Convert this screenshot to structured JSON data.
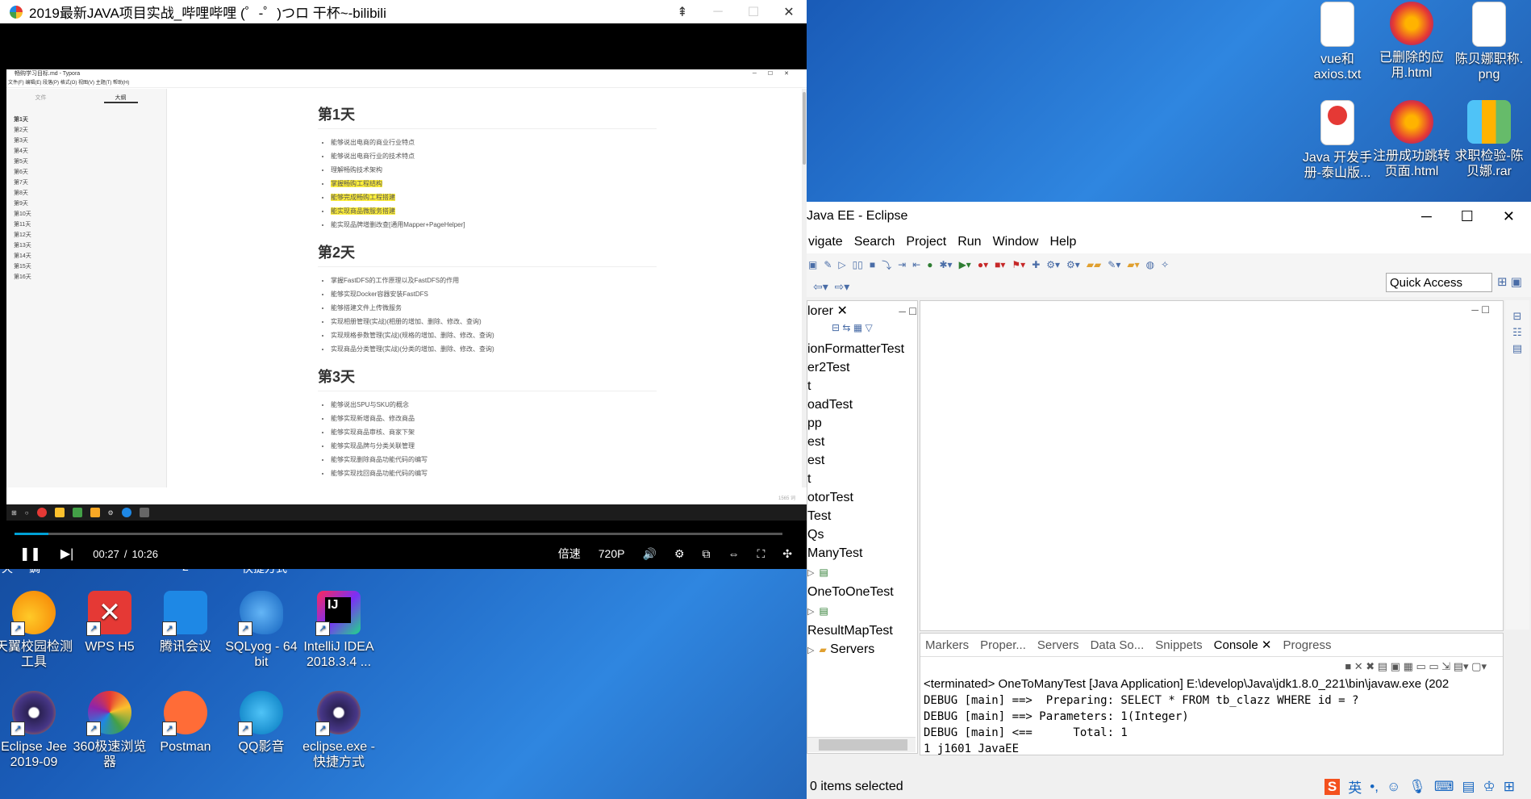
{
  "player": {
    "title": "2019最新JAVA项目实战_哔哩哔哩 (゜-゜)つロ 干杯~-bilibili",
    "time_current": "00:27",
    "time_sep": "/",
    "time_total": "10:26",
    "speed_label": "倍速",
    "quality_label": "720P",
    "progress_fraction": 0.044
  },
  "typora": {
    "window_title": "畅购学习目标.md - Typora",
    "menu": [
      "文件(F)",
      "编辑(E)",
      "段落(P)",
      "格式(O)",
      "视图(V)",
      "主题(T)",
      "帮助(H)"
    ],
    "tab_files": "文件",
    "tab_outline": "大纲",
    "outline": [
      "第1天",
      "第2天",
      "第3天",
      "第4天",
      "第5天",
      "第6天",
      "第7天",
      "第8天",
      "第9天",
      "第10天",
      "第11天",
      "第12天",
      "第13天",
      "第14天",
      "第15天",
      "第16天"
    ],
    "day1_title": "第1天",
    "day1_items": [
      "能够说出电商的商业行业特点",
      "能够说出电商行业的技术特点",
      "理解畅购技术架构",
      "掌握畅购工程结构",
      "能够完成畅购工程搭建",
      "能实现商品微服务搭建",
      "能实现品牌增删改查[通用Mapper+PageHelper]"
    ],
    "day2_title": "第2天",
    "day2_items": [
      "掌握FastDFS的工作原理以及FastDFS的作用",
      "能够实现Docker容器安装FastDFS",
      "能够搭建文件上传微服务",
      "实现相册管理(实战)(相册的增加、删除、修改、查询)",
      "实现规格参数管理(实战)(规格的增加、删除、修改、查询)",
      "实现商品分类管理(实战)(分类的增加、删除、修改、查询)"
    ],
    "day3_title": "第3天",
    "day3_items": [
      "能够说出SPU与SKU的概念",
      "能够实现新增商品、修改商品",
      "能够实现商品审核、商家下架",
      "能够实现品牌与分类关联管理",
      "能够实现删除商品功能代码的编写",
      "能够实现找回商品功能代码的编写"
    ],
    "word_count": "1565 词"
  },
  "desktop_icons": [
    {
      "label": "vue和\naxios.txt",
      "icon": "text-file-icon"
    },
    {
      "label": "已删除的应\n用.html",
      "icon": "firefox-icon"
    },
    {
      "label": "陈贝娜职称.\npng",
      "icon": "image-file-icon"
    },
    {
      "label": "Java 开发手\n册-泰山版...",
      "icon": "pdf-icon"
    },
    {
      "label": "注册成功跳转\n页面.html",
      "icon": "firefox-icon"
    },
    {
      "label": "求职检验-陈\n贝娜.rar",
      "icon": "rar-icon"
    },
    {
      "label": "天翼校园检测\n工具",
      "icon": "tianyi-icon"
    },
    {
      "label": "WPS H5",
      "icon": "wps-icon"
    },
    {
      "label": "腾讯会议",
      "icon": "tencent-meeting-icon"
    },
    {
      "label": "SQLyog - 64\nbit",
      "icon": "sqlyog-icon"
    },
    {
      "label": "IntelliJ IDEA\n2018.3.4 ...",
      "icon": "intellij-icon"
    },
    {
      "label": "Eclipse Jee\n2019-09",
      "icon": "eclipse-icon"
    },
    {
      "label": "360极速浏览\n器",
      "icon": "360-browser-icon"
    },
    {
      "label": "Postman",
      "icon": "postman-icon"
    },
    {
      "label": "QQ影音",
      "icon": "qq-player-icon"
    },
    {
      "label": "eclipse.exe -\n快捷方式",
      "icon": "eclipse-icon"
    }
  ],
  "partial_labels": [
    "天",
    "鋦",
    "2",
    "快捷方式"
  ],
  "eclipse": {
    "title": "Java EE - Eclipse",
    "menu": [
      "vigate",
      "Search",
      "Project",
      "Run",
      "Window",
      "Help"
    ],
    "quick_access": "Quick Access",
    "explorer_tab": "lorer",
    "tree_items": [
      "ionFormatterTest",
      "er2Test",
      "t",
      "oadTest",
      "pp",
      "est",
      "est",
      "t",
      "otorTest",
      "Test",
      "Qs",
      "ManyTest",
      "OneToOneTest",
      "ResultMapTest",
      "Servers"
    ],
    "console_tabs": [
      "Markers",
      "Proper...",
      "Servers",
      "Data So...",
      "Snippets",
      "Console",
      "Progress"
    ],
    "terminated": "<terminated> OneToManyTest [Java Application] E:\\develop\\Java\\jdk1.8.0_221\\bin\\javaw.exe (202",
    "console_lines": [
      "DEBUG [main] ==>  Preparing: SELECT * FROM tb_clazz WHERE id = ? ",
      "DEBUG [main] ==> Parameters: 1(Integer)",
      "DEBUG [main] <==      Total: 1",
      "1 j1601 JavaEE"
    ],
    "status": "0 items selected",
    "ime_label": "英"
  }
}
